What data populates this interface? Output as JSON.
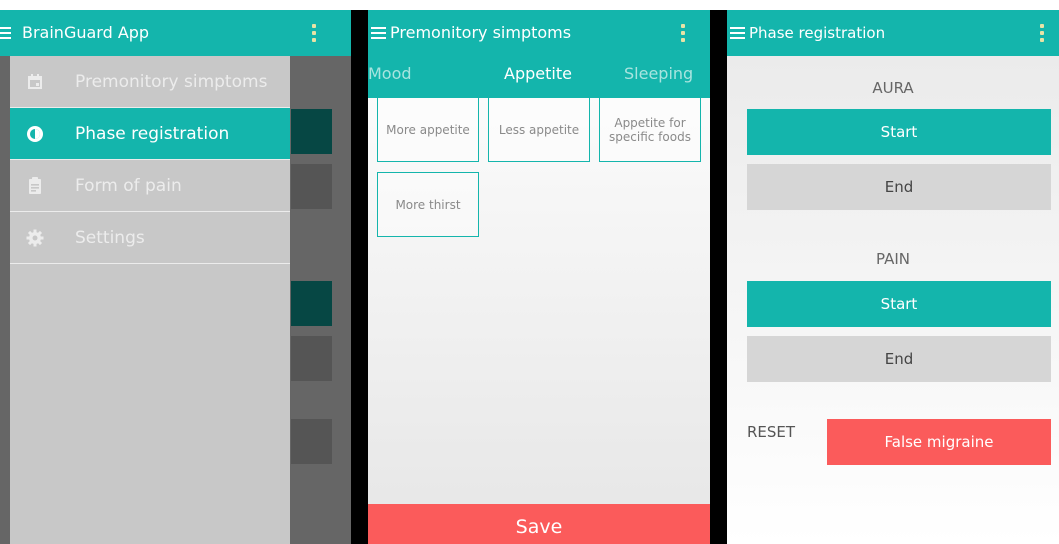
{
  "panel1": {
    "app_title": "BrainGuard App",
    "drawer_items": [
      {
        "label": "Premonitory simptoms",
        "icon": "calendar-icon",
        "active": false
      },
      {
        "label": "Phase registration",
        "icon": "clock-icon",
        "active": true
      },
      {
        "label": "Form of pain",
        "icon": "clipboard-icon",
        "active": false
      },
      {
        "label": "Settings",
        "icon": "gear-icon",
        "active": false
      }
    ]
  },
  "panel2": {
    "title": "Premonitory simptoms",
    "tabs": [
      "Mood",
      "Appetite",
      "Sleeping"
    ],
    "selected_tab": "Appetite",
    "options": [
      "More appetite",
      "Less appetite",
      "Appetite for specific foods",
      "More thirst"
    ],
    "save_label": "Save"
  },
  "panel3": {
    "title": "Phase registration",
    "aura": {
      "heading": "AURA",
      "start_label": "Start",
      "end_label": "End"
    },
    "pain": {
      "heading": "PAIN",
      "start_label": "Start",
      "end_label": "End"
    },
    "reset_label": "RESET",
    "false_migraine_label": "False migraine"
  },
  "colors": {
    "accent": "#14b5ac",
    "danger": "#fb5b5b",
    "end_button": "#d6d6d6",
    "drawer": "#c8c8c8",
    "overlay": "#666666",
    "overflow_dots": "#e9e3a6"
  }
}
